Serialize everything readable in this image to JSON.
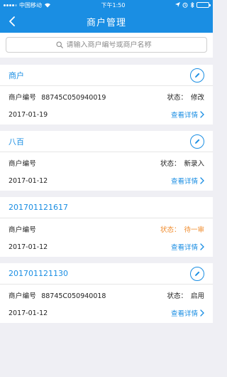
{
  "status_bar": {
    "carrier": "中国移动",
    "time": "下午1:50"
  },
  "nav": {
    "title": "商户管理"
  },
  "search": {
    "placeholder": "请输入商户编号或商户名称"
  },
  "labels": {
    "code": "商户编号",
    "status": "状态：",
    "detail": "查看详情"
  },
  "merchants": [
    {
      "name": "商户",
      "code": "88745C050940019",
      "status": "修改",
      "date": "2017-01-19",
      "editable": true
    },
    {
      "name": "八百",
      "code": "",
      "status": "新录入",
      "date": "2017-01-12",
      "editable": true
    },
    {
      "name": "201701121617",
      "code": "",
      "status": "待一审",
      "date": "2017-01-12",
      "editable": false
    },
    {
      "name": "201701121130",
      "code": "88745C050940018",
      "status": "启用",
      "date": "2017-01-12",
      "editable": true
    }
  ],
  "colors": {
    "primary": "#1a8ee3",
    "pending": "#f08c2e"
  },
  "icons": [
    "back-arrow-icon",
    "search-icon",
    "edit-pencil-icon",
    "chevron-right-icon"
  ]
}
